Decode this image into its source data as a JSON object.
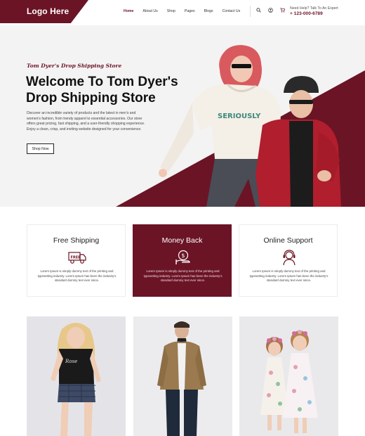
{
  "brand": {
    "logo": "Logo Here",
    "color": "#6b1426"
  },
  "nav": {
    "items": [
      {
        "label": "Home",
        "active": true
      },
      {
        "label": "About Us",
        "active": false
      },
      {
        "label": "Shop",
        "active": false
      },
      {
        "label": "Pages",
        "active": false
      },
      {
        "label": "Blogs",
        "active": false
      },
      {
        "label": "Contact Us",
        "active": false
      }
    ],
    "icons": [
      "search-icon",
      "user-icon",
      "cart-icon"
    ]
  },
  "contact": {
    "label": "Need Help? Talk To An Expert",
    "phone": "+ 123-000-6789"
  },
  "hero": {
    "tagline": "Tom Dyer's Drop Shipping Store",
    "title": "Welcome To Tom Dyer's Drop Shipping Store",
    "description": "Discover an incredible variety of products and the latest in men's and women's fashion, from trendy apparel to essential accessories. Our store offers great pricing, fast shipping, and a user-friendly shopping experience. Enjoy a clean, crisp, and inviting website designed for your convenience.",
    "button": "Shop Now"
  },
  "features": [
    {
      "title": "Free Shipping",
      "icon": "truck-icon",
      "text": "Lorem Ipsum is simply dummy text of the printing and typesetting industry. Lorem Ipsum has been the industry's standard dummy text ever since."
    },
    {
      "title": "Money Back",
      "icon": "money-back-icon",
      "text": "Lorem Ipsum is simply dummy text of the printing and typesetting industry. Lorem Ipsum has been the industry's standard dummy text ever since."
    },
    {
      "title": "Online Support",
      "icon": "support-icon",
      "text": "Lorem Ipsum is simply dummy text of the printing and typesetting industry. Lorem Ipsum has been the industry's standard dummy text ever since."
    }
  ],
  "products": [
    {
      "image": "woman-fashion-image"
    },
    {
      "image": "man-jacket-image"
    },
    {
      "image": "kids-dresses-image"
    }
  ]
}
